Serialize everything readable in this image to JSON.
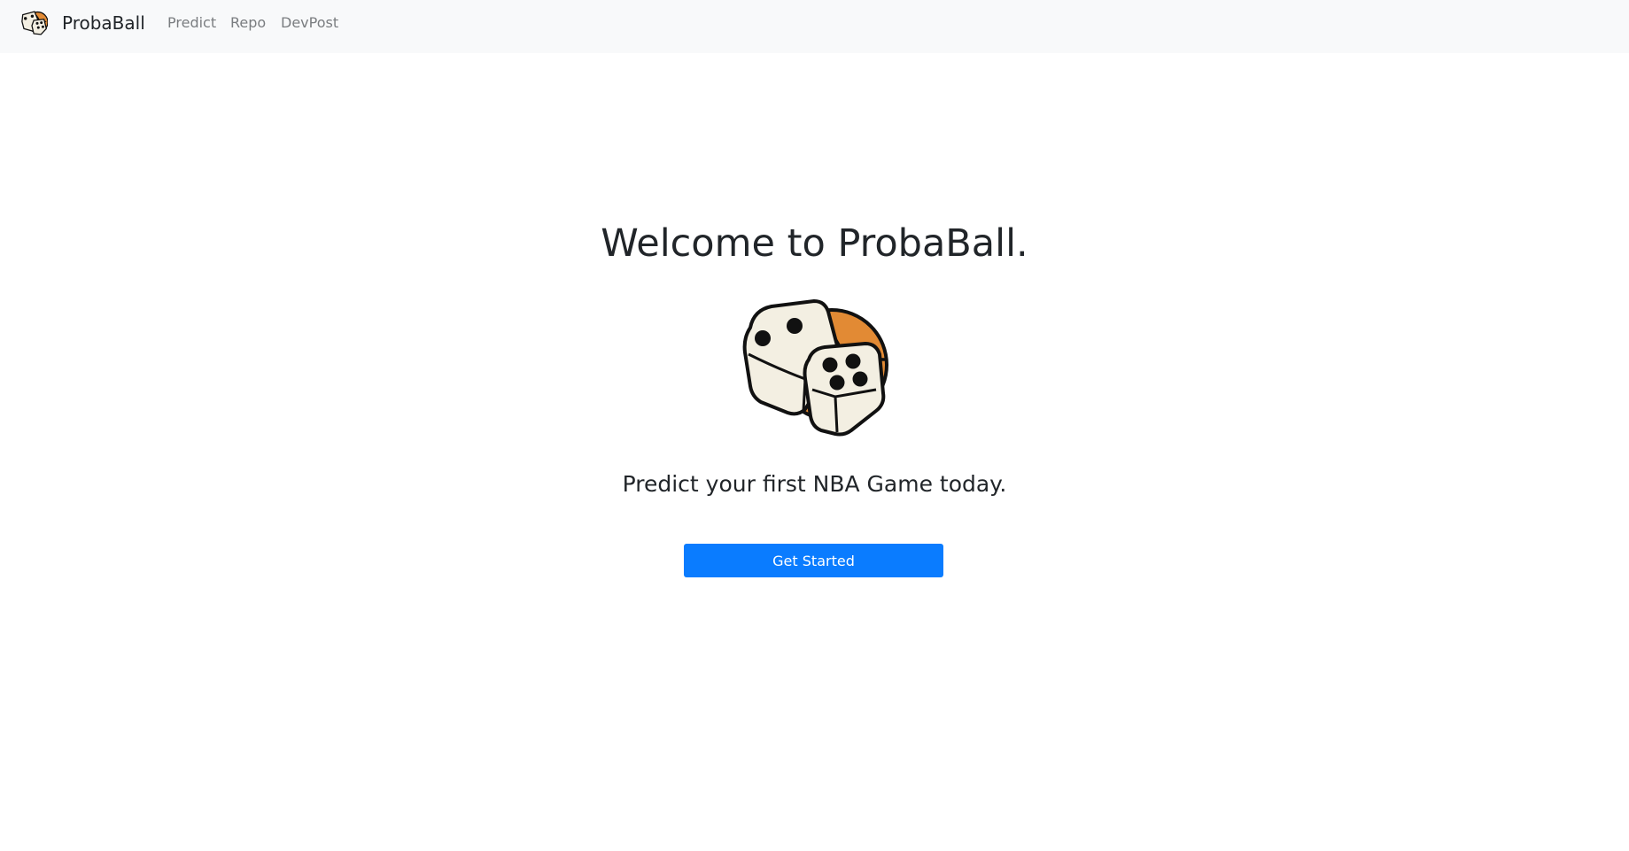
{
  "navbar": {
    "brand": "ProbaBall",
    "links": [
      {
        "label": "Predict"
      },
      {
        "label": "Repo"
      },
      {
        "label": "DevPost"
      }
    ]
  },
  "hero": {
    "title": "Welcome to ProbaBall.",
    "logo_icon": "dice-basketball-icon",
    "subtitle": "Predict your first NBA Game today.",
    "cta_label": "Get Started"
  },
  "colors": {
    "navbar_bg": "#f8f9fa",
    "primary": "#0a7cff",
    "basketball": "#e28a34",
    "die_face": "#f3efe2",
    "text": "#212529",
    "nav_link": "#7a7d80"
  }
}
